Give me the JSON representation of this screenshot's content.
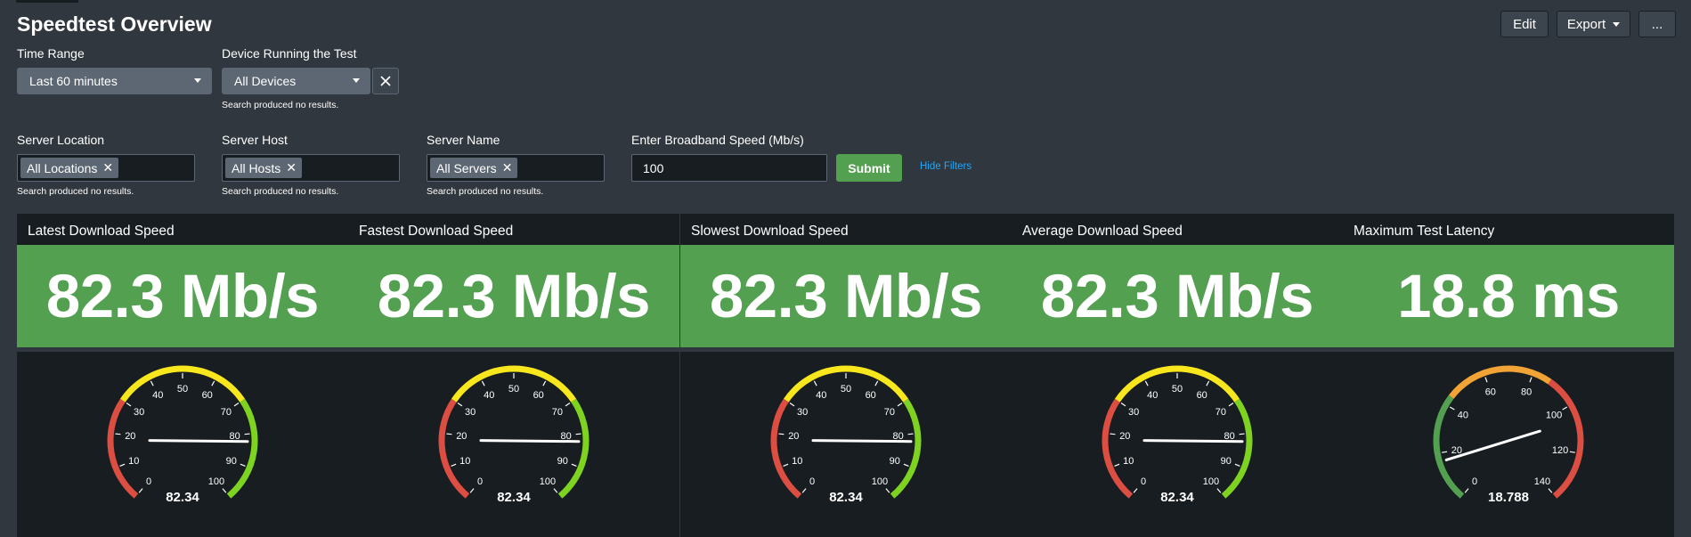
{
  "header": {
    "title": "Speedtest Overview",
    "edit_label": "Edit",
    "export_label": "Export",
    "more_label": "..."
  },
  "filters": {
    "time_range": {
      "label": "Time Range",
      "value": "Last 60 minutes"
    },
    "device": {
      "label": "Device Running the Test",
      "value": "All Devices",
      "note": "Search produced no results."
    },
    "server_location": {
      "label": "Server Location",
      "token": "All Locations",
      "note": "Search produced no results."
    },
    "server_host": {
      "label": "Server Host",
      "token": "All Hosts",
      "note": "Search produced no results."
    },
    "server_name": {
      "label": "Server Name",
      "token": "All Servers",
      "note": "Search produced no results."
    },
    "broadband": {
      "label": "Enter Broadband Speed (Mb/s)",
      "value": "100"
    },
    "submit_label": "Submit",
    "hide_filters_label": "Hide Filters"
  },
  "colors": {
    "background": "#31373e",
    "panel": "#171d21",
    "success": "#53a051",
    "red": "#dc4e41",
    "yellow": "#f8e71c",
    "green_light": "#7ed321",
    "orange": "#f1a335",
    "link": "#1ea7fd"
  },
  "panels": [
    {
      "title": "Latest Download Speed",
      "value": "82.3 Mb/s",
      "gauge": {
        "value": 82.34,
        "value_label": "82.34",
        "min": 0,
        "max": 100,
        "ticks": [
          "0",
          "10",
          "20",
          "30",
          "40",
          "50",
          "60",
          "70",
          "80",
          "90",
          "100"
        ],
        "bands": [
          {
            "from": 0,
            "to": 30,
            "color": "#dc4e41"
          },
          {
            "from": 30,
            "to": 70,
            "color": "#f8e71c"
          },
          {
            "from": 70,
            "to": 100,
            "color": "#7ed321"
          }
        ]
      }
    },
    {
      "title": "Fastest Download Speed",
      "value": "82.3 Mb/s",
      "gauge": {
        "value": 82.34,
        "value_label": "82.34",
        "min": 0,
        "max": 100,
        "ticks": [
          "0",
          "10",
          "20",
          "30",
          "40",
          "50",
          "60",
          "70",
          "80",
          "90",
          "100"
        ],
        "bands": [
          {
            "from": 0,
            "to": 30,
            "color": "#dc4e41"
          },
          {
            "from": 30,
            "to": 70,
            "color": "#f8e71c"
          },
          {
            "from": 70,
            "to": 100,
            "color": "#7ed321"
          }
        ]
      }
    },
    {
      "title": "Slowest Download Speed",
      "value": "82.3 Mb/s",
      "gauge": {
        "value": 82.34,
        "value_label": "82.34",
        "min": 0,
        "max": 100,
        "ticks": [
          "0",
          "10",
          "20",
          "30",
          "40",
          "50",
          "60",
          "70",
          "80",
          "90",
          "100"
        ],
        "bands": [
          {
            "from": 0,
            "to": 30,
            "color": "#dc4e41"
          },
          {
            "from": 30,
            "to": 70,
            "color": "#f8e71c"
          },
          {
            "from": 70,
            "to": 100,
            "color": "#7ed321"
          }
        ]
      }
    },
    {
      "title": "Average Download Speed",
      "value": "82.3 Mb/s",
      "gauge": {
        "value": 82.34,
        "value_label": "82.34",
        "min": 0,
        "max": 100,
        "ticks": [
          "0",
          "10",
          "20",
          "30",
          "40",
          "50",
          "60",
          "70",
          "80",
          "90",
          "100"
        ],
        "bands": [
          {
            "from": 0,
            "to": 30,
            "color": "#dc4e41"
          },
          {
            "from": 30,
            "to": 70,
            "color": "#f8e71c"
          },
          {
            "from": 70,
            "to": 100,
            "color": "#7ed321"
          }
        ]
      }
    },
    {
      "title": "Maximum Test Latency",
      "value": "18.8 ms",
      "gauge": {
        "value": 18.788,
        "value_label": "18.788",
        "min": 0,
        "max": 160,
        "ticks": [
          "0",
          "20",
          "40",
          "60",
          "80",
          "100",
          "120",
          "140"
        ],
        "bands": [
          {
            "from": 0,
            "to": 50,
            "color": "#53a051"
          },
          {
            "from": 50,
            "to": 100,
            "color": "#f1a335"
          },
          {
            "from": 100,
            "to": 160,
            "color": "#dc4e41"
          }
        ]
      }
    }
  ]
}
